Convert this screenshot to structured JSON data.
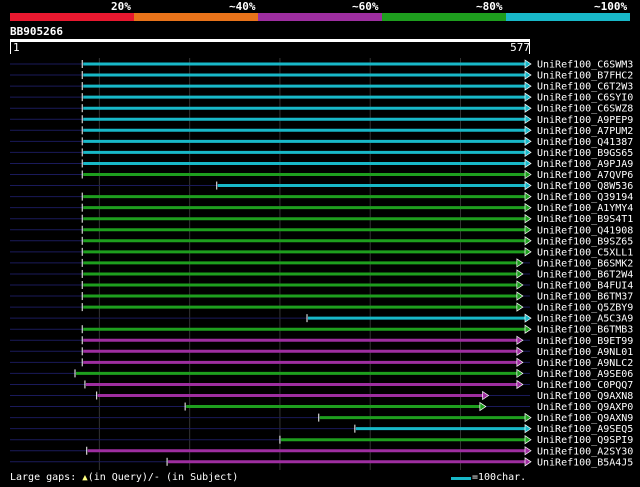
{
  "score_scale": {
    "labels": [
      "20%",
      "~40%",
      "~60%",
      "~80%",
      "~100%"
    ],
    "colors": [
      "#e8182f",
      "#e8731a",
      "#9e2ea0",
      "#1e9e1e",
      "#18b8c8"
    ]
  },
  "query": {
    "title": "BB905266",
    "start": "1",
    "end": "577",
    "length": 577
  },
  "hits": [
    {
      "name": "UniRef100_C6SWM3",
      "start": 81,
      "end": 577,
      "color": "#18b8c8"
    },
    {
      "name": "UniRef100_B7FHC2",
      "start": 81,
      "end": 577,
      "color": "#18b8c8"
    },
    {
      "name": "UniRef100_C6T2W3",
      "start": 81,
      "end": 577,
      "color": "#18b8c8"
    },
    {
      "name": "UniRef100_C6SYI0",
      "start": 81,
      "end": 577,
      "color": "#18b8c8"
    },
    {
      "name": "UniRef100_C6SWZ8",
      "start": 81,
      "end": 577,
      "color": "#18b8c8"
    },
    {
      "name": "UniRef100_A9PEP9",
      "start": 81,
      "end": 577,
      "color": "#18b8c8"
    },
    {
      "name": "UniRef100_A7PUM2",
      "start": 81,
      "end": 577,
      "color": "#18b8c8"
    },
    {
      "name": "UniRef100_Q41387",
      "start": 81,
      "end": 577,
      "color": "#18b8c8"
    },
    {
      "name": "UniRef100_B9GS65",
      "start": 81,
      "end": 577,
      "color": "#18b8c8"
    },
    {
      "name": "UniRef100_A9PJA9",
      "start": 81,
      "end": 577,
      "color": "#18b8c8"
    },
    {
      "name": "UniRef100_A7QVP6",
      "start": 81,
      "end": 577,
      "color": "#1e9e1e"
    },
    {
      "name": "UniRef100_Q8W536",
      "start": 230,
      "end": 577,
      "color": "#18b8c8"
    },
    {
      "name": "UniRef100_Q39194",
      "start": 81,
      "end": 577,
      "color": "#1e9e1e"
    },
    {
      "name": "UniRef100_A1YMY4",
      "start": 81,
      "end": 577,
      "color": "#1e9e1e"
    },
    {
      "name": "UniRef100_B9S4T1",
      "start": 81,
      "end": 577,
      "color": "#1e9e1e"
    },
    {
      "name": "UniRef100_Q41908",
      "start": 81,
      "end": 577,
      "color": "#1e9e1e"
    },
    {
      "name": "UniRef100_B9SZ65",
      "start": 81,
      "end": 577,
      "color": "#1e9e1e"
    },
    {
      "name": "UniRef100_C5XLL1",
      "start": 81,
      "end": 577,
      "color": "#1e9e1e"
    },
    {
      "name": "UniRef100_B6SMK2",
      "start": 81,
      "end": 568,
      "color": "#1e9e1e"
    },
    {
      "name": "UniRef100_B6T2W4",
      "start": 81,
      "end": 568,
      "color": "#1e9e1e"
    },
    {
      "name": "UniRef100_B4FUI4",
      "start": 81,
      "end": 568,
      "color": "#1e9e1e"
    },
    {
      "name": "UniRef100_B6TM37",
      "start": 81,
      "end": 568,
      "color": "#1e9e1e"
    },
    {
      "name": "UniRef100_Q5ZBY9",
      "start": 81,
      "end": 568,
      "color": "#1e9e1e"
    },
    {
      "name": "UniRef100_A5C3A9",
      "start": 330,
      "end": 577,
      "color": "#18b8c8"
    },
    {
      "name": "UniRef100_B6TMB3",
      "start": 81,
      "end": 577,
      "color": "#1e9e1e"
    },
    {
      "name": "UniRef100_B9ET99",
      "start": 81,
      "end": 568,
      "color": "#9e2ea0"
    },
    {
      "name": "UniRef100_A9NL01",
      "start": 81,
      "end": 568,
      "color": "#9e2ea0"
    },
    {
      "name": "UniRef100_A9NLC2",
      "start": 81,
      "end": 568,
      "color": "#9e2ea0"
    },
    {
      "name": "UniRef100_A9SE06",
      "start": 73,
      "end": 568,
      "color": "#1e9e1e"
    },
    {
      "name": "UniRef100_C0PQQ7",
      "start": 84,
      "end": 568,
      "color": "#9e2ea0"
    },
    {
      "name": "UniRef100_Q9AXN8",
      "start": 97,
      "end": 530,
      "color": "#9e2ea0"
    },
    {
      "name": "UniRef100_Q9AXP0",
      "start": 195,
      "end": 527,
      "color": "#1e9e1e"
    },
    {
      "name": "UniRef100_Q9AXN9",
      "start": 343,
      "end": 577,
      "color": "#1e9e1e"
    },
    {
      "name": "UniRef100_A9SEQ5",
      "start": 383,
      "end": 577,
      "color": "#18b8c8"
    },
    {
      "name": "UniRef100_Q9SPI9",
      "start": 300,
      "end": 577,
      "color": "#1e9e1e"
    },
    {
      "name": "UniRef100_A2SY30",
      "start": 86,
      "end": 577,
      "color": "#9e2ea0"
    },
    {
      "name": "UniRef100_B5A4J5",
      "start": 175,
      "end": 577,
      "color": "#9e2ea0"
    }
  ],
  "footer": {
    "gaps_prefix": "Large gaps:",
    "gaps_query": "(in Query)/",
    "gaps_subject": "(in Subject)",
    "legend_label": "=100char.",
    "legend_color": "#18b8c8"
  }
}
